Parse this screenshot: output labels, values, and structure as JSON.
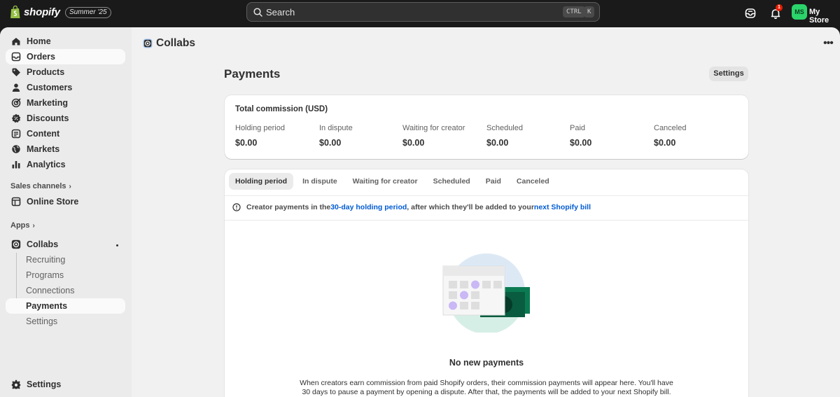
{
  "topbar": {
    "brand": "shopify",
    "edition": "Summer '25",
    "search_placeholder": "Search",
    "shortcut_ctrl": "CTRL",
    "shortcut_key": "K",
    "notification_count": "1",
    "avatar_initials": "MS",
    "store_name": "My Store"
  },
  "sidebar": {
    "items": [
      {
        "label": "Home",
        "icon": "home-icon"
      },
      {
        "label": "Orders",
        "icon": "orders-icon"
      },
      {
        "label": "Products",
        "icon": "tag-icon"
      },
      {
        "label": "Customers",
        "icon": "person-icon"
      },
      {
        "label": "Marketing",
        "icon": "target-icon"
      },
      {
        "label": "Discounts",
        "icon": "discount-icon"
      },
      {
        "label": "Content",
        "icon": "content-icon"
      },
      {
        "label": "Markets",
        "icon": "globe-icon"
      },
      {
        "label": "Analytics",
        "icon": "bar-chart-icon"
      }
    ],
    "sales_channels_label": "Sales channels",
    "online_store_label": "Online Store",
    "apps_label": "Apps",
    "collabs_label": "Collabs",
    "collabs_subitems": [
      "Recruiting",
      "Programs",
      "Connections",
      "Payments",
      "Settings"
    ],
    "settings_label": "Settings"
  },
  "main": {
    "app_title": "Collabs",
    "page_title": "Payments",
    "settings_button": "Settings",
    "summary": {
      "title": "Total commission (USD)",
      "stats": [
        {
          "label": "Holding period",
          "value": "$0.00"
        },
        {
          "label": "In dispute",
          "value": "$0.00"
        },
        {
          "label": "Waiting for creator",
          "value": "$0.00"
        },
        {
          "label": "Scheduled",
          "value": "$0.00"
        },
        {
          "label": "Paid",
          "value": "$0.00"
        },
        {
          "label": "Canceled",
          "value": "$0.00"
        }
      ]
    },
    "tabs": [
      "Holding period",
      "In dispute",
      "Waiting for creator",
      "Scheduled",
      "Paid",
      "Canceled"
    ],
    "active_tab": "Holding period",
    "info": {
      "prefix": "Creator payments in the ",
      "link1": "30-day holding period",
      "middle": ", after which they'll be added to your ",
      "link2": "next Shopify bill"
    },
    "empty": {
      "title": "No new payments",
      "description": "When creators earn commission from paid Shopify orders, their commission payments will appear here. You'll have 30 days to pause a payment by opening a dispute. After that, the payments will be added to your next Shopify bill."
    }
  },
  "colors": {
    "topbar_bg": "#1a1a1a",
    "canvas_bg": "#f1f1f1",
    "sidebar_bg": "#ebebeb",
    "link": "#005bd3",
    "avatar_bg": "#2bd46a",
    "illustration_green": "#0b7a53"
  }
}
